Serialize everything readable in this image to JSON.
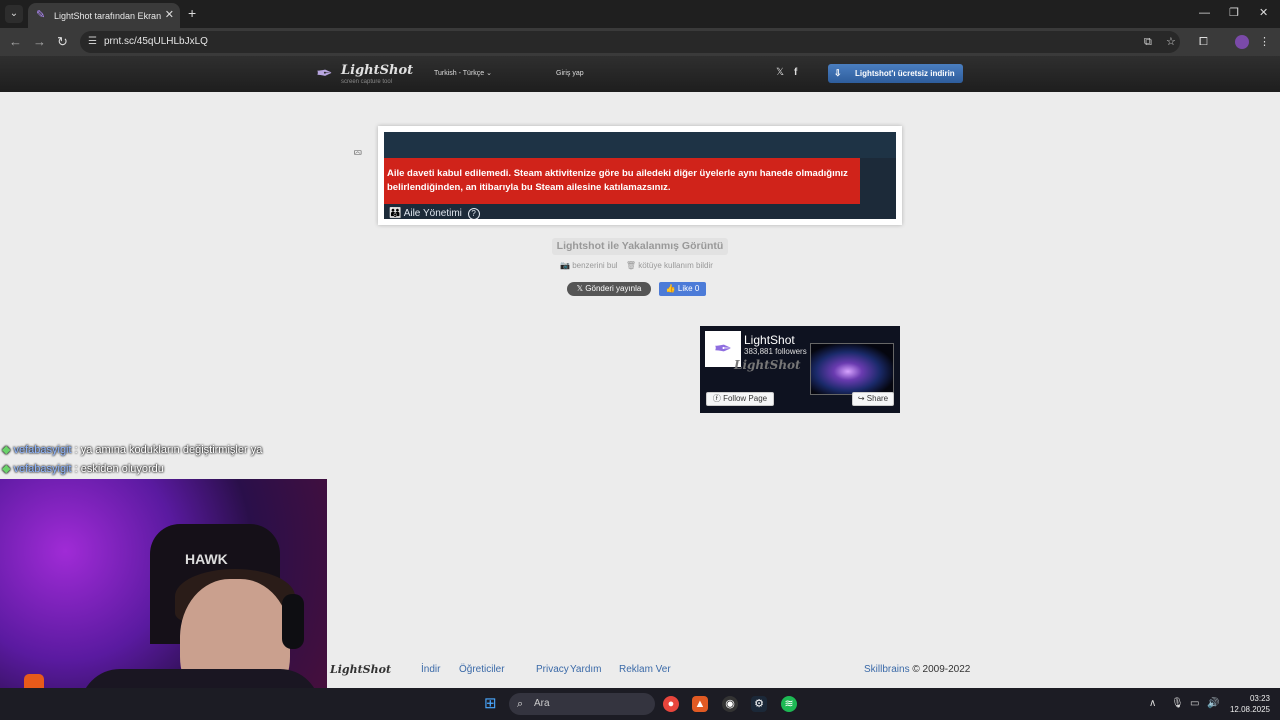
{
  "browser": {
    "tab_title": "LightShot tarafından Ekran Görüntüsü",
    "url": "prnt.sc/45qULHLbJxLQ"
  },
  "site": {
    "logo_text": "LightShot",
    "logo_sub": "screen capture tool",
    "language": "Turkish - Türkçe",
    "login": "Giriş yap",
    "twitter_glyph": "𝕏",
    "facebook_glyph": "f",
    "download_button": "Lightshot'ı ücretsiz indirin"
  },
  "screenshot": {
    "alert_text": "Aile daveti kabul edilemedi. Steam aktivitenize göre bu ailedeki diğer üyelerle aynı hanede olmadığınız belirlendiğinden, an itibarıyla bu Steam ailesine katılamazsınız.",
    "family_label": "Aile Yönetimi",
    "help_glyph": "?"
  },
  "caption": {
    "title": "Lightshot ile Yakalanmış Görüntü",
    "find_similar": "benzerini bul",
    "report_abuse": "kötüye kullanım bildir",
    "tweet": "𝕏 Gönderi yayınla",
    "like": "Like 0"
  },
  "fb_widget": {
    "name": "LightShot",
    "followers": "383,881 followers",
    "bg_logo": "LightShot",
    "follow": "Follow Page",
    "share": "Share"
  },
  "chat": [
    {
      "user": "vefabasyigit",
      "message": " : ya amına kodukların değiştirmişler ya"
    },
    {
      "user": "vefabasyigit",
      "message": " : eskiden oluyordu"
    }
  ],
  "webcam": {
    "chair_brand": "HAWK"
  },
  "footer": {
    "logo": "LightShot",
    "links": [
      "İndir",
      "Öğreticiler",
      "Privacy",
      "Yardım",
      "Reklam Ver"
    ],
    "brand": "Skillbrains",
    "copyright": " © 2009-2022"
  },
  "taskbar": {
    "search_placeholder": "Ara",
    "time": "03:23",
    "date": "12.08.2025"
  },
  "colors": {
    "alert_red": "#d0231a",
    "download_blue": "#2e5d9c",
    "link_blue": "#3b6aa8",
    "page_bg": "#ececec"
  }
}
